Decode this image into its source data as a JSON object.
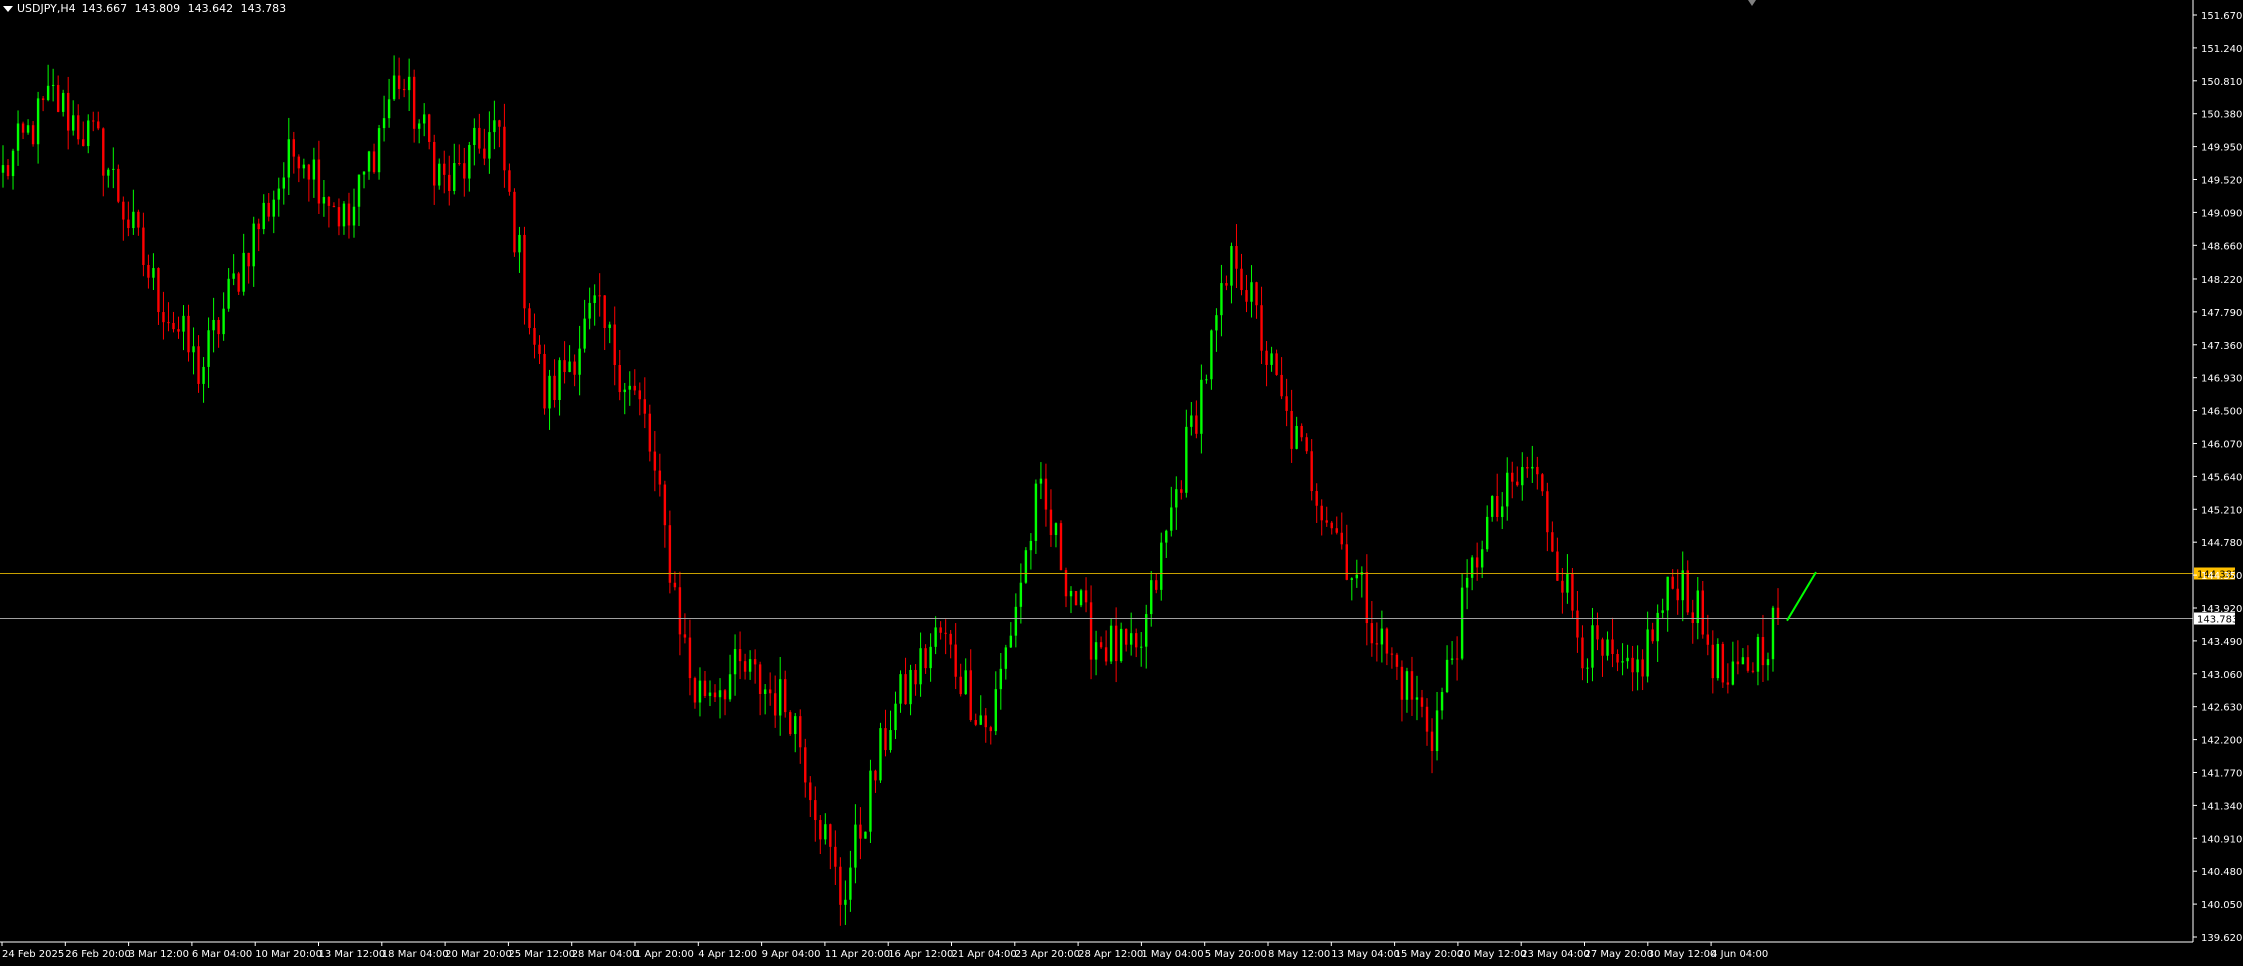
{
  "header": {
    "symbol_tf": "USDJPY,H4",
    "ohlc": [
      "143.667",
      "143.809",
      "143.642",
      "143.783"
    ]
  },
  "colors": {
    "background": "#000000",
    "bull": "#00ff00",
    "bear": "#ff0000",
    "axis": "#ffffff",
    "grid_text": "#ffffff",
    "h_line_gold": "#c8a000",
    "h_line_price": "#a0a0a0",
    "label_gold_bg": "#ffc000",
    "trend_line": "#00ff00"
  },
  "chart_data": {
    "type": "candlestick",
    "symbol": "USDJPY",
    "timeframe": "H4",
    "y_range": [
      139.62,
      151.67
    ],
    "y_ticks": [
      "151.670",
      "151.240",
      "150.810",
      "150.380",
      "149.950",
      "149.520",
      "149.090",
      "148.660",
      "148.220",
      "147.790",
      "147.360",
      "146.930",
      "146.500",
      "146.070",
      "145.640",
      "145.210",
      "144.780",
      "144.350",
      "143.920",
      "143.490",
      "143.060",
      "142.630",
      "142.200",
      "141.770",
      "141.340",
      "140.910",
      "140.480",
      "140.050",
      "139.620"
    ],
    "x_ticks": [
      "24 Feb 2025",
      "26 Feb 20:00",
      "3 Mar 12:00",
      "6 Mar 04:00",
      "10 Mar 20:00",
      "13 Mar 12:00",
      "18 Mar 04:00",
      "20 Mar 20:00",
      "25 Mar 12:00",
      "28 Mar 04:00",
      "1 Apr 20:00",
      "4 Apr 12:00",
      "9 Apr 04:00",
      "11 Apr 20:00",
      "16 Apr 12:00",
      "21 Apr 04:00",
      "23 Apr 20:00",
      "28 Apr 12:00",
      "1 May 04:00",
      "5 May 20:00",
      "8 May 12:00",
      "13 May 04:00",
      "15 May 20:00",
      "20 May 12:00",
      "23 May 04:00",
      "27 May 20:00",
      "30 May 12:00",
      "4 Jun 04:00"
    ],
    "horizontal_lines": [
      {
        "price": 144.382,
        "label": "144.382",
        "style": "gold"
      },
      {
        "price": 143.783,
        "label": "143.783",
        "style": "current"
      }
    ],
    "key_closes": [
      149.6,
      150.6,
      149.9,
      148.2,
      147.0,
      148.7,
      150.0,
      148.9,
      150.9,
      149.4,
      150.2,
      146.6,
      147.8,
      146.4,
      142.8,
      143.1,
      142.6,
      140.1,
      142.5,
      143.6,
      142.3,
      145.4,
      143.6,
      143.2,
      146.0,
      148.6,
      146.4,
      145.0,
      143.4,
      142.3,
      144.9,
      145.8,
      143.5,
      142.9,
      144.4,
      142.8,
      143.783
    ],
    "trend_line": {
      "from": 143.78,
      "to": 144.35
    }
  }
}
